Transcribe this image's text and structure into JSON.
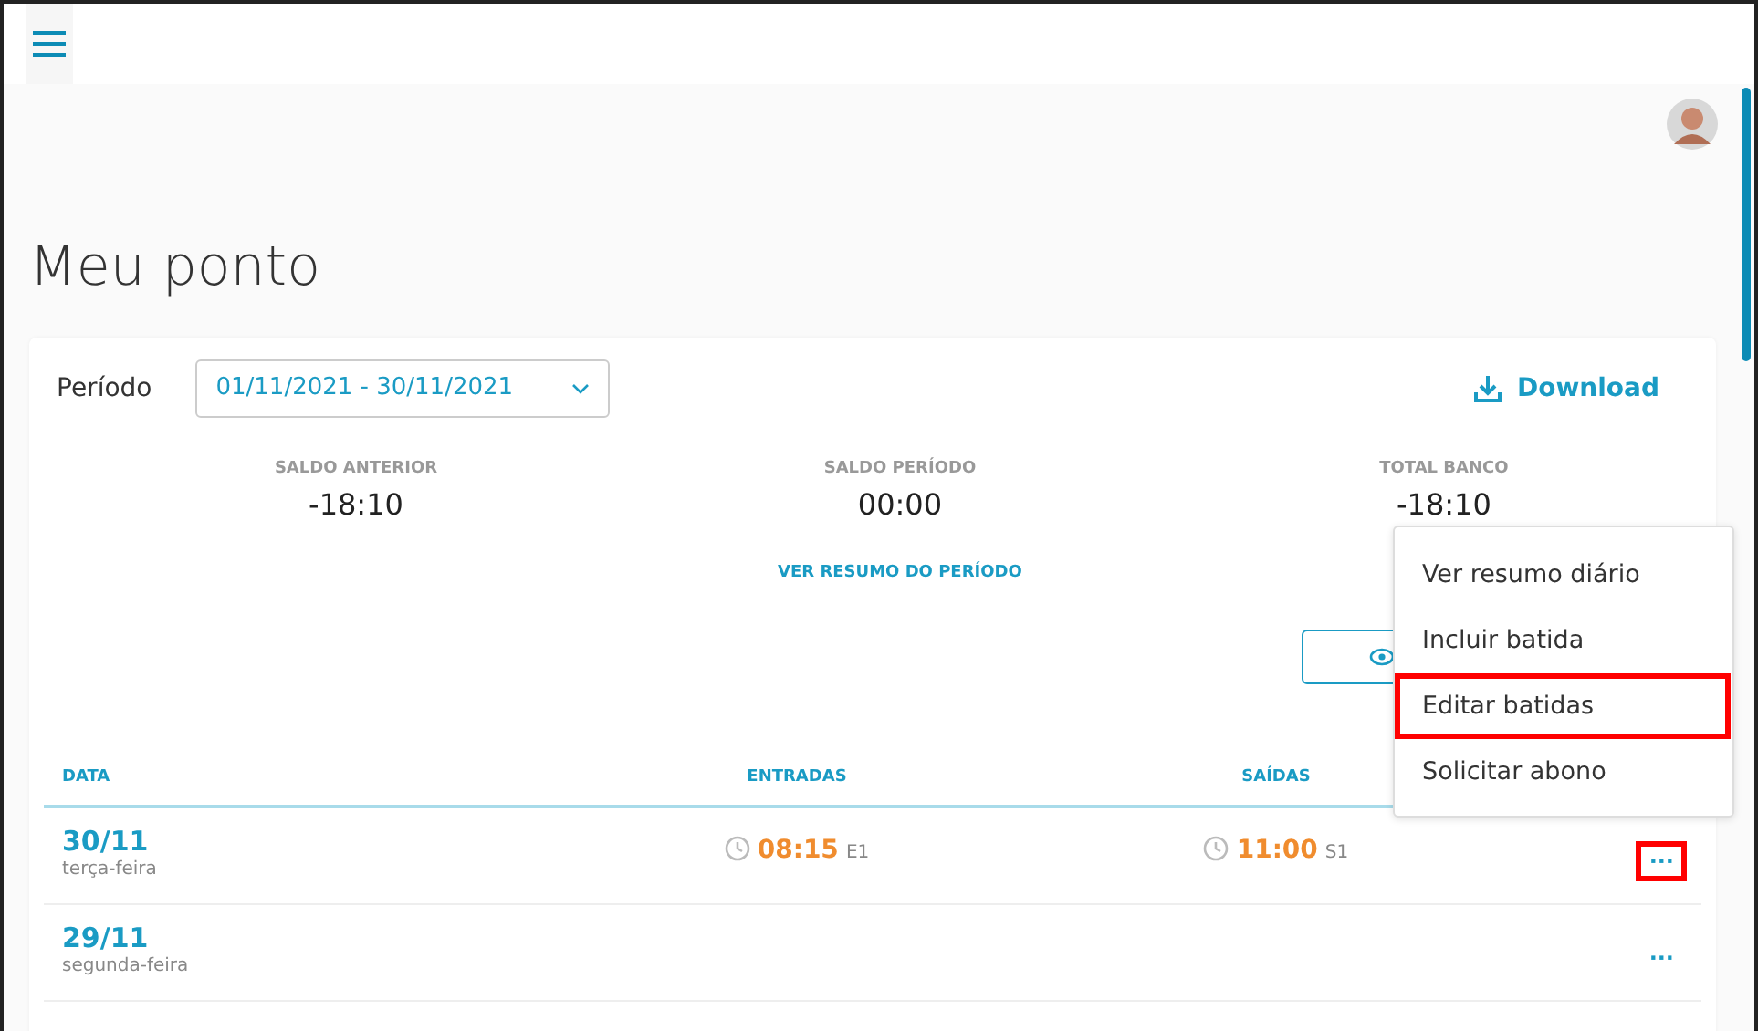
{
  "page_title": "Meu ponto",
  "period": {
    "label": "Período",
    "value": "01/11/2021 - 30/11/2021"
  },
  "download": {
    "label": "Download"
  },
  "summary": [
    {
      "label": "SALDO ANTERIOR",
      "value": "-18:10"
    },
    {
      "label": "SALDO PERÍODO",
      "value": "00:00",
      "link": "VER RESUMO DO PERÍODO"
    },
    {
      "label": "TOTAL BANCO",
      "value": "-18:10"
    }
  ],
  "table": {
    "columns": [
      "DATA",
      "ENTRADAS",
      "SAÍDAS"
    ],
    "rows": [
      {
        "date": "30/11",
        "weekday": "terça-feira",
        "entry": {
          "time": "08:15",
          "tag": "E1"
        },
        "exit": {
          "time": "11:00",
          "tag": "S1"
        },
        "more": "···",
        "highlighted": true
      },
      {
        "date": "29/11",
        "weekday": "segunda-feira",
        "more": "···",
        "highlighted": false
      }
    ]
  },
  "menu": {
    "items": [
      {
        "label": "Ver resumo diário",
        "highlighted": false
      },
      {
        "label": "Incluir batida",
        "highlighted": false
      },
      {
        "label": "Editar batidas",
        "highlighted": true
      },
      {
        "label": "Solicitar abono",
        "highlighted": false
      }
    ]
  }
}
